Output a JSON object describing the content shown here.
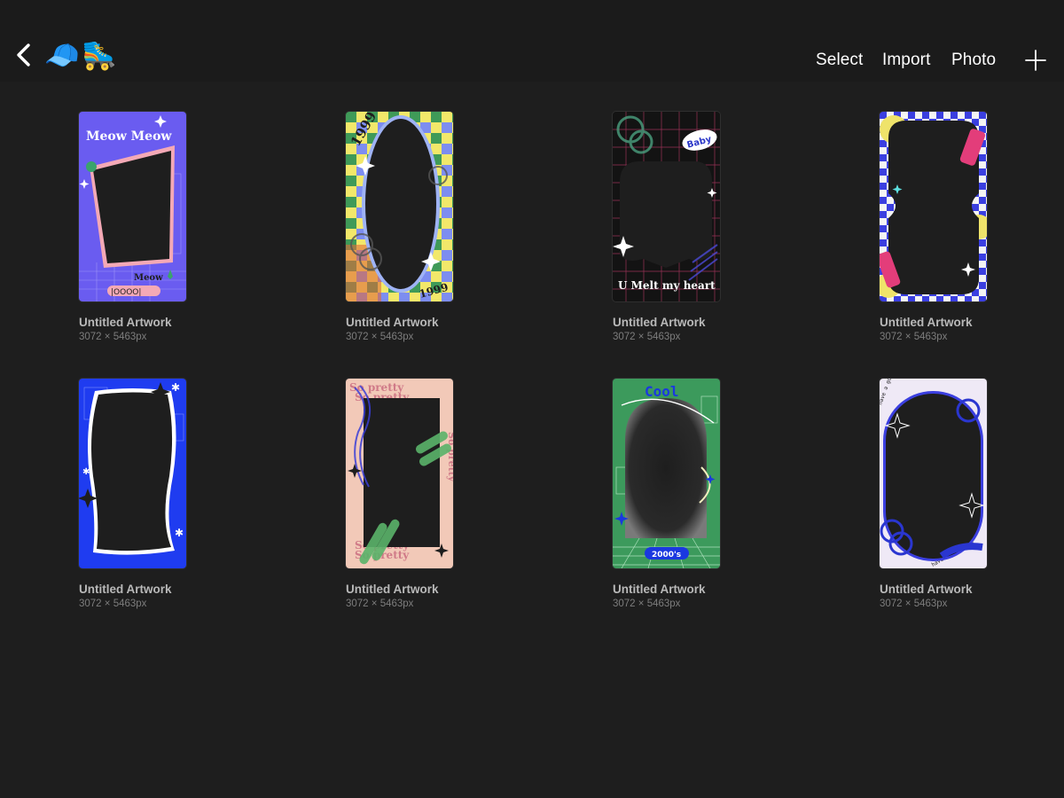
{
  "topbar": {
    "back_icon": "chevron-left-icon",
    "title_emojis": [
      "🧢",
      "🛼"
    ],
    "buttons": {
      "select": "Select",
      "import": "Import",
      "photo": "Photo"
    },
    "add_icon": "plus-icon"
  },
  "artworks": [
    {
      "name": "Untitled Artwork",
      "dims": "3072 × 5463px",
      "texts": [
        "Meow Meow",
        "Meow",
        "|OOOO|"
      ]
    },
    {
      "name": "Untitled Artwork",
      "dims": "3072 × 5463px",
      "texts": [
        "1999",
        "1999"
      ]
    },
    {
      "name": "Untitled Artwork",
      "dims": "3072 × 5463px",
      "texts": [
        "Baby",
        "U Melt my heart"
      ]
    },
    {
      "name": "Untitled Artwork",
      "dims": "3072 × 5463px",
      "texts": []
    },
    {
      "name": "Untitled Artwork",
      "dims": "3072 × 5463px",
      "texts": []
    },
    {
      "name": "Untitled Artwork",
      "dims": "3072 × 5463px",
      "texts": [
        "So pretty",
        "So pretty",
        "So pretty",
        "So pretty",
        "So pretty"
      ]
    },
    {
      "name": "Untitled Artwork",
      "dims": "3072 × 5463px",
      "texts": [
        "Cool",
        "2000's"
      ]
    },
    {
      "name": "Untitled Artwork",
      "dims": "3072 × 5463px",
      "texts": [
        "have a good day",
        "have a good day"
      ]
    }
  ],
  "colors": {
    "background": "#1e1e1e",
    "topbar": "#1b1b1b",
    "label": "#b9b9b9",
    "sublabel": "#7d7d7d"
  }
}
